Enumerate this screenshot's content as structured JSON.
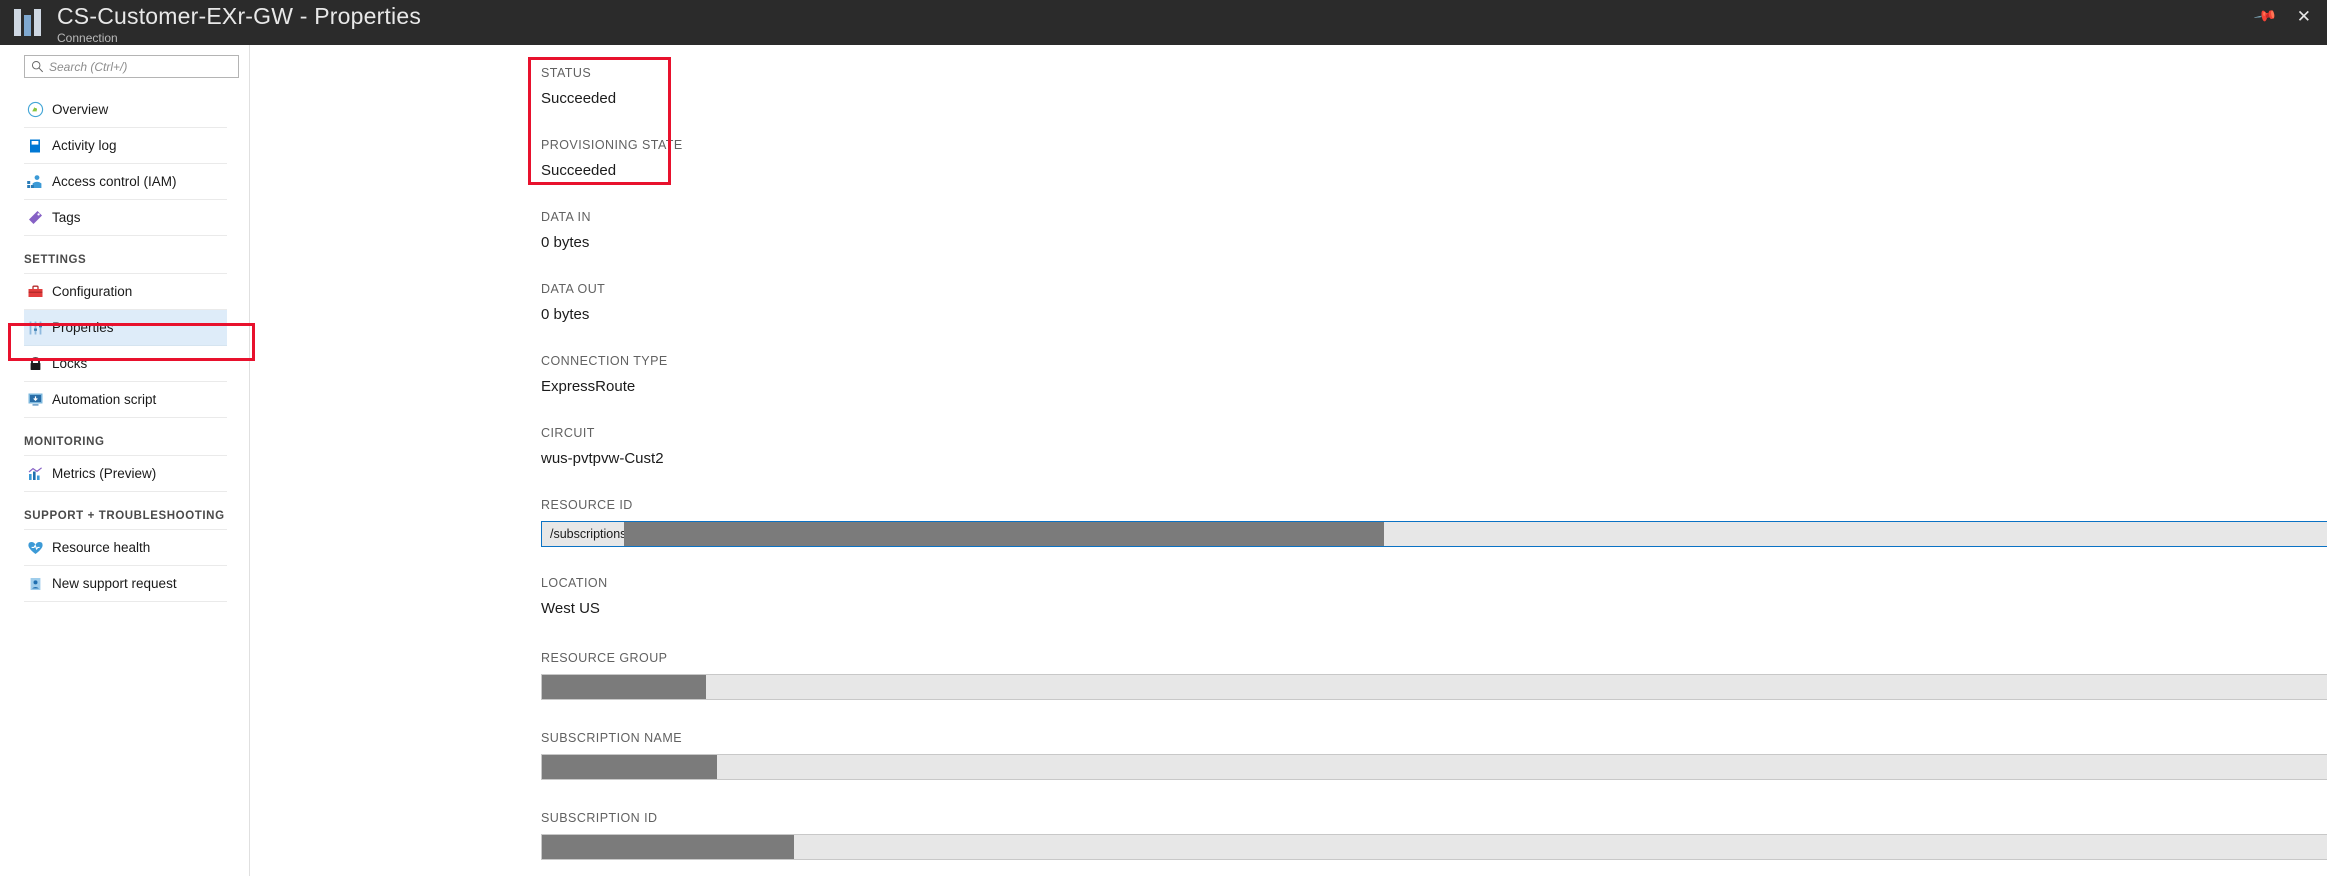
{
  "titlebar": {
    "title": "CS-Customer-EXr-GW - Properties",
    "subtitle": "Connection",
    "pin_icon": "pin-icon",
    "close_icon": "close-icon",
    "close_glyph": "✕",
    "pin_glyph": "ὌC"
  },
  "search": {
    "placeholder": "Search (Ctrl+/)",
    "value": "",
    "icon": "search-icon"
  },
  "collapse": {
    "glyph": "«",
    "name": "collapse-nav-button"
  },
  "nav": {
    "items": [
      {
        "label": "Overview",
        "icon": "overview-icon",
        "selected": false
      },
      {
        "label": "Activity log",
        "icon": "activity-log-icon",
        "selected": false
      },
      {
        "label": "Access control (IAM)",
        "icon": "access-control-icon",
        "selected": false
      },
      {
        "label": "Tags",
        "icon": "tags-icon",
        "selected": false
      }
    ],
    "groups": [
      {
        "title": "SETTINGS",
        "items": [
          {
            "label": "Configuration",
            "icon": "configuration-icon",
            "selected": false
          },
          {
            "label": "Properties",
            "icon": "properties-icon",
            "selected": true
          },
          {
            "label": "Locks",
            "icon": "lock-icon",
            "selected": false
          },
          {
            "label": "Automation script",
            "icon": "automation-script-icon",
            "selected": false
          }
        ]
      },
      {
        "title": "MONITORING",
        "items": [
          {
            "label": "Metrics (Preview)",
            "icon": "metrics-icon",
            "selected": false
          }
        ]
      },
      {
        "title": "SUPPORT + TROUBLESHOOTING",
        "items": [
          {
            "label": "Resource health",
            "icon": "resource-health-icon",
            "selected": false
          },
          {
            "label": "New support request",
            "icon": "new-support-request-icon",
            "selected": false
          }
        ]
      }
    ]
  },
  "properties": {
    "status": {
      "label": "STATUS",
      "value": "Succeeded"
    },
    "provisioning_state": {
      "label": "PROVISIONING STATE",
      "value": "Succeeded"
    },
    "data_in": {
      "label": "DATA IN",
      "value": "0 bytes"
    },
    "data_out": {
      "label": "DATA OUT",
      "value": "0 bytes"
    },
    "connection_type": {
      "label": "CONNECTION TYPE",
      "value": "ExpressRoute"
    },
    "circuit": {
      "label": "CIRCUIT",
      "value": "wus-pvtpvw-Cust2"
    },
    "resource_id": {
      "label": "RESOURCE ID",
      "value": "/subscriptions"
    },
    "location": {
      "label": "LOCATION",
      "value": "West US"
    },
    "resource_group": {
      "label": "RESOURCE GROUP",
      "value": ""
    },
    "subscription_name": {
      "label": "SUBSCRIPTION NAME",
      "value": ""
    },
    "subscription_id": {
      "label": "SUBSCRIPTION ID",
      "value": ""
    }
  },
  "copy_buttons": {
    "name": "copy-to-clipboard-button",
    "icon": "copy-icon"
  },
  "colors": {
    "titlebar_bg": "#2b2b2b",
    "selection_bg": "#deecf9",
    "highlight_border": "#e8112d",
    "accent_blue": "#0f6cbd",
    "redaction_gray": "#7b7b7b"
  }
}
